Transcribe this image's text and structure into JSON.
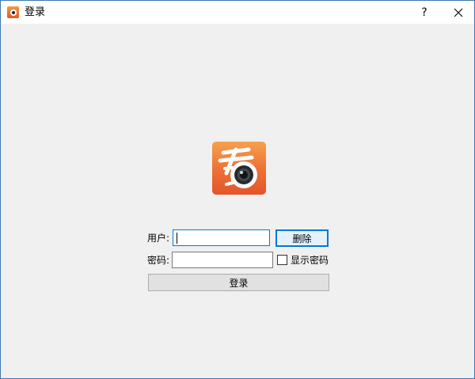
{
  "window": {
    "title": "登录",
    "help_label": "?"
  },
  "logo": {
    "glyph": "看"
  },
  "form": {
    "user_label": "用户:",
    "user_value": "",
    "delete_label": "删除",
    "password_label": "密码:",
    "password_value": "",
    "show_password_label": "显示密码",
    "show_password_checked": false,
    "login_label": "登录"
  },
  "colors": {
    "accent": "#0078d7",
    "logo_top": "#f6a04e",
    "logo_bottom": "#e4542a",
    "background": "#f0f0f0"
  }
}
